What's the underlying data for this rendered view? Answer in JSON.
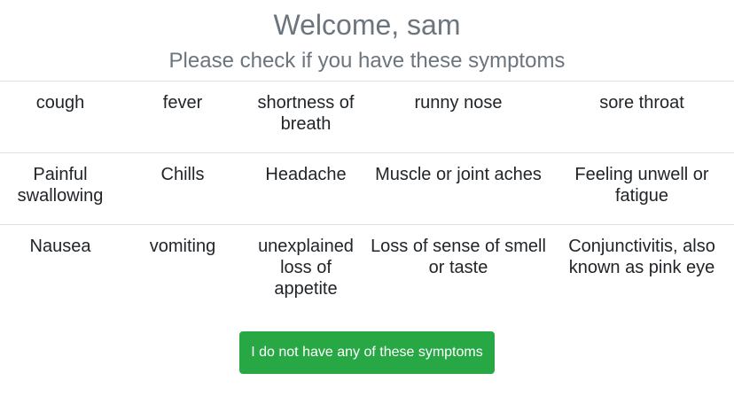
{
  "header": {
    "welcome": "Welcome, sam",
    "prompt": "Please check if you have these symptoms"
  },
  "symptoms": {
    "rows": [
      [
        "cough",
        "fever",
        "shortness of breath",
        "runny nose",
        "sore throat"
      ],
      [
        "Painful swallowing",
        "Chills",
        "Headache",
        "Muscle or joint aches",
        "Feeling unwell or fatigue"
      ],
      [
        "Nausea",
        "vomiting",
        "unexplained loss of appetite",
        "Loss of sense of smell or taste",
        "Conjunctivitis, also known as pink eye"
      ]
    ]
  },
  "actions": {
    "none_label": "I do not have any of these symptoms"
  },
  "colors": {
    "accent": "#28a745",
    "muted_text": "#6c757d",
    "divider": "#dee2e6"
  }
}
